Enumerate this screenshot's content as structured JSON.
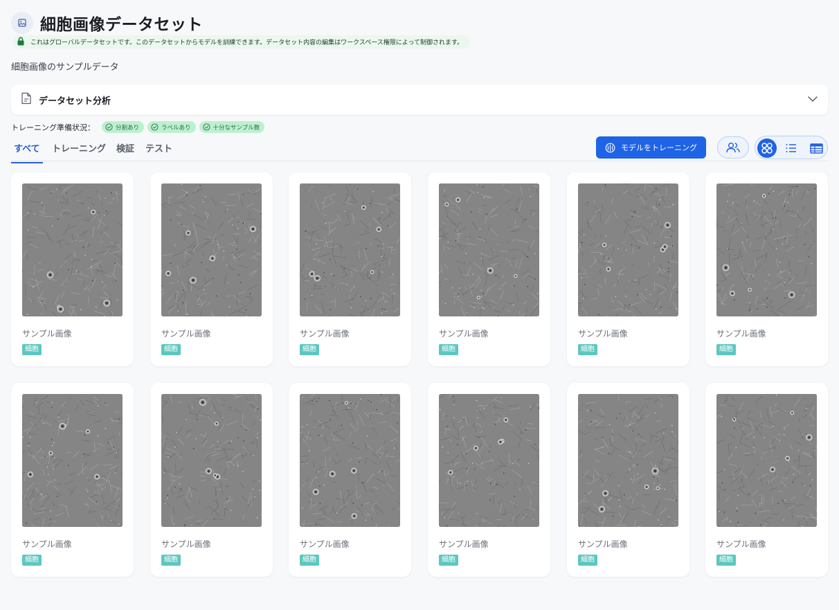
{
  "header": {
    "title": "細胞画像データセット",
    "notice": "これはグローバルデータセットです。このデータセットからモデルを訓練できます。データセット内容の編集はワークスペース権限によって制御されます。",
    "subtitle": "細胞画像のサンプルデータ"
  },
  "analysis": {
    "title": "データセット分析"
  },
  "readiness": {
    "label": "トレーニング準備状況：",
    "badges": [
      "分割あり",
      "ラベルあり",
      "十分なサンプル数"
    ]
  },
  "tabs": [
    {
      "label": "すべて",
      "active": true
    },
    {
      "label": "トレーニング",
      "active": false
    },
    {
      "label": "検証",
      "active": false
    },
    {
      "label": "テスト",
      "active": false
    }
  ],
  "actions": {
    "train_label": "モデルをトレーニング"
  },
  "view_modes": [
    "grid-icon",
    "list-icon",
    "table-icon"
  ],
  "active_view": "grid-icon",
  "colors": {
    "accent": "#1f63e6",
    "tag": "#5cc7bf",
    "ready_badge": "#bdf0cf",
    "notice_bg": "#eaf8ee"
  },
  "samples": [
    {
      "label": "サンプル画像",
      "tag": "細胞"
    },
    {
      "label": "サンプル画像",
      "tag": "細胞"
    },
    {
      "label": "サンプル画像",
      "tag": "細胞"
    },
    {
      "label": "サンプル画像",
      "tag": "細胞"
    },
    {
      "label": "サンプル画像",
      "tag": "細胞"
    },
    {
      "label": "サンプル画像",
      "tag": "細胞"
    },
    {
      "label": "サンプル画像",
      "tag": "細胞"
    },
    {
      "label": "サンプル画像",
      "tag": "細胞"
    },
    {
      "label": "サンプル画像",
      "tag": "細胞"
    },
    {
      "label": "サンプル画像",
      "tag": "細胞"
    },
    {
      "label": "サンプル画像",
      "tag": "細胞"
    },
    {
      "label": "サンプル画像",
      "tag": "細胞"
    }
  ]
}
